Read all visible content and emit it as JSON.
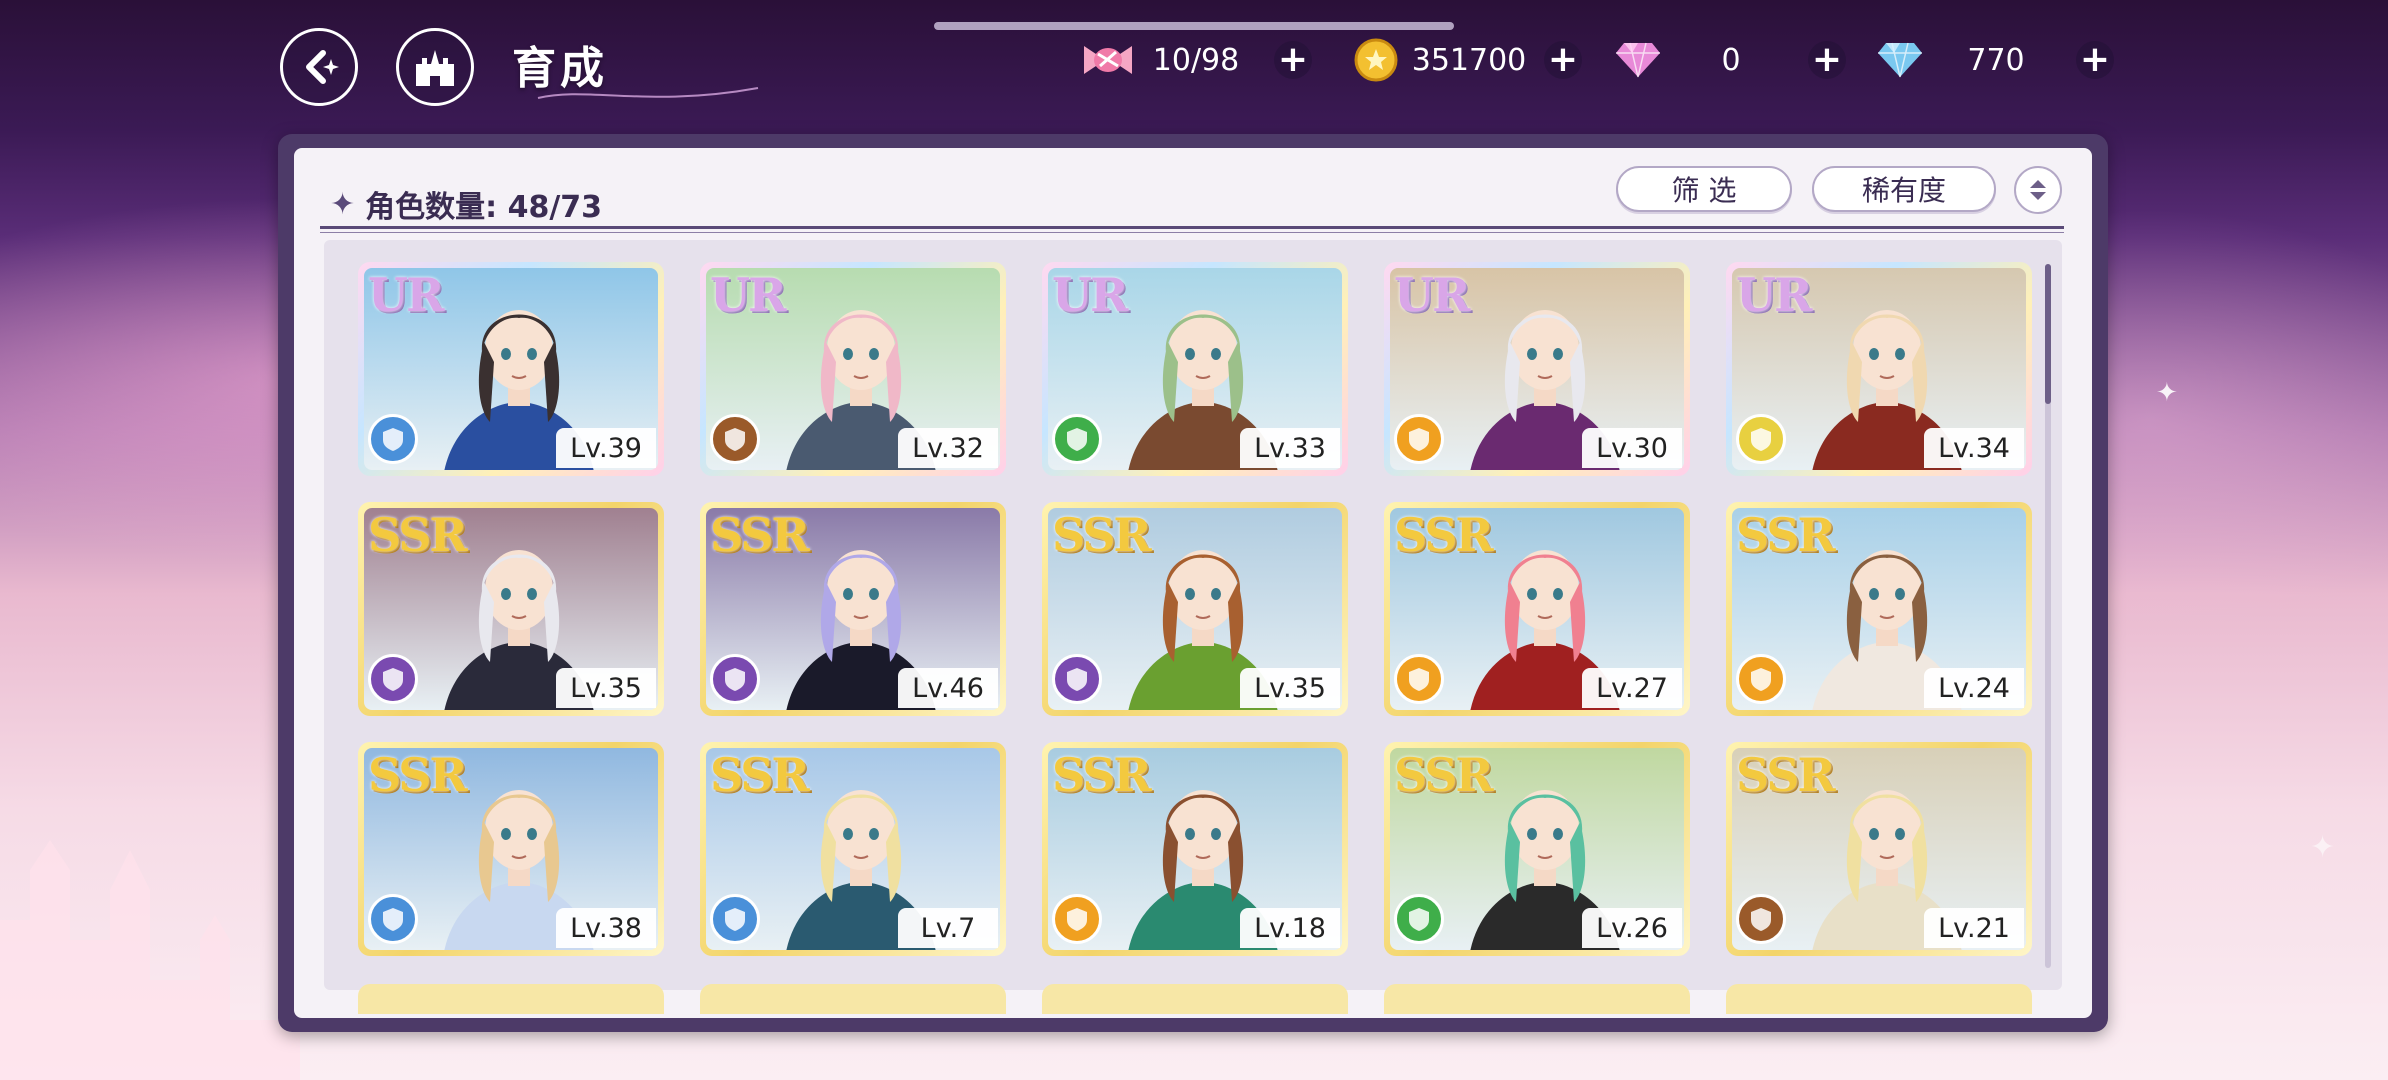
{
  "header": {
    "title": "育成",
    "back_icon": "back-icon",
    "home_icon": "castle-icon"
  },
  "resources": [
    {
      "name": "candy",
      "icon": "candy-icon",
      "value": "10/98",
      "color": "#f07aa8"
    },
    {
      "name": "coin",
      "icon": "coin-icon",
      "value": "351700",
      "color": "#f3c030"
    },
    {
      "name": "pink-diamond",
      "icon": "pink-diamond-icon",
      "value": "0",
      "color": "#e88ad8"
    },
    {
      "name": "blue-diamond",
      "icon": "blue-diamond-icon",
      "value": "770",
      "color": "#7ac8f0"
    }
  ],
  "panel": {
    "count_label": "角色数量: 48/73",
    "filter_label": "筛 选",
    "rarity_label": "稀有度",
    "sort_icon": "sort-toggle-icon"
  },
  "characters": [
    {
      "rarity": "UR",
      "level": "Lv.39",
      "element_color": "#4a90d9",
      "hair": "#3a3030",
      "outfit": "#2a4fa0",
      "bg": "#8fc6e8"
    },
    {
      "rarity": "UR",
      "level": "Lv.32",
      "element_color": "#9a5a2a",
      "hair": "#f0b8c8",
      "outfit": "#4a5a70",
      "bg": "#b7dcb0"
    },
    {
      "rarity": "UR",
      "level": "Lv.33",
      "element_color": "#3fae4a",
      "hair": "#9cc08a",
      "outfit": "#7a4a30",
      "bg": "#a9d6e8"
    },
    {
      "rarity": "UR",
      "level": "Lv.30",
      "element_color": "#f0a020",
      "hair": "#e8e8ee",
      "outfit": "#6a2a70",
      "bg": "#d8c4a6"
    },
    {
      "rarity": "UR",
      "level": "Lv.34",
      "element_color": "#e8d040",
      "hair": "#f0d8b0",
      "outfit": "#8a2a20",
      "bg": "#d6c8b0"
    },
    {
      "rarity": "SSR",
      "level": "Lv.35",
      "element_color": "#7a4ab0",
      "hair": "#e8e8ee",
      "outfit": "#2a2a3a",
      "bg": "#a08090"
    },
    {
      "rarity": "SSR",
      "level": "Lv.46",
      "element_color": "#7a4ab0",
      "hair": "#b0a8e8",
      "outfit": "#1a1a2a",
      "bg": "#8a7aa8"
    },
    {
      "rarity": "SSR",
      "level": "Lv.35",
      "element_color": "#7a4ab0",
      "hair": "#a86030",
      "outfit": "#6aa030",
      "bg": "#b0cce0"
    },
    {
      "rarity": "SSR",
      "level": "Lv.27",
      "element_color": "#f0a020",
      "hair": "#f08090",
      "outfit": "#a02020",
      "bg": "#a0c8e0"
    },
    {
      "rarity": "SSR",
      "level": "Lv.24",
      "element_color": "#f0a020",
      "hair": "#8a6040",
      "outfit": "#f0e8e0",
      "bg": "#a8d0e8"
    },
    {
      "rarity": "SSR",
      "level": "Lv.38",
      "element_color": "#4a90d9",
      "hair": "#e8c890",
      "outfit": "#c8d8f0",
      "bg": "#90b8e0"
    },
    {
      "rarity": "SSR",
      "level": "Lv.7",
      "element_color": "#4a90d9",
      "hair": "#f0e0a0",
      "outfit": "#2a5a70",
      "bg": "#a8c8e8"
    },
    {
      "rarity": "SSR",
      "level": "Lv.18",
      "element_color": "#f0a020",
      "hair": "#8a5030",
      "outfit": "#2a8a70",
      "bg": "#a8cce0"
    },
    {
      "rarity": "SSR",
      "level": "Lv.26",
      "element_color": "#3fae4a",
      "hair": "#5ac0a0",
      "outfit": "#2a2a2a",
      "bg": "#c0d8a0"
    },
    {
      "rarity": "SSR",
      "level": "Lv.21",
      "element_color": "#9a5a2a",
      "hair": "#f0e0a0",
      "outfit": "#e8e0c8",
      "bg": "#d8d0b8"
    }
  ]
}
